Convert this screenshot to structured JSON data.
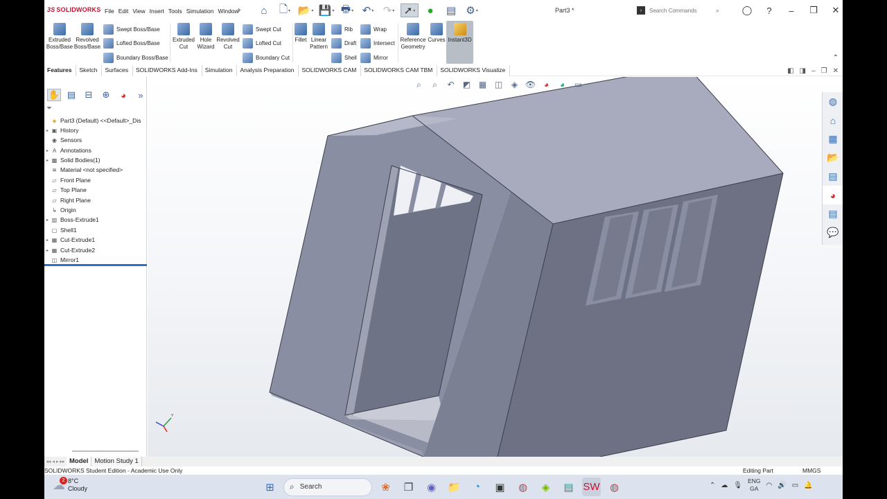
{
  "app": {
    "logo": "SOLIDWORKS",
    "menu": [
      "File",
      "Edit",
      "View",
      "Insert",
      "Tools",
      "Simulation",
      "Window"
    ],
    "document_title": "Part3 *",
    "search_placeholder": "Search Commands"
  },
  "ribbon": {
    "extruded_boss": "Extruded Boss/Base",
    "revolved_boss": "Revolved Boss/Base",
    "swept_boss": "Swept Boss/Base",
    "lofted_boss": "Lofted Boss/Base",
    "boundary_boss": "Boundary Boss/Base",
    "extruded_cut": "Extruded Cut",
    "hole_wizard": "Hole Wizard",
    "revolved_cut": "Revolved Cut",
    "swept_cut": "Swept Cut",
    "lofted_cut": "Lofted Cut",
    "boundary_cut": "Boundary Cut",
    "fillet": "Fillet",
    "linear_pattern": "Linear Pattern",
    "rib": "Rib",
    "draft": "Draft",
    "shell": "Shell",
    "wrap": "Wrap",
    "intersect": "Intersect",
    "mirror": "Mirror",
    "reference_geometry": "Reference Geometry",
    "curves": "Curves",
    "instant3d": "Instant3D"
  },
  "tabs": [
    "Features",
    "Sketch",
    "Surfaces",
    "SOLIDWORKS Add-Ins",
    "Simulation",
    "Analysis Preparation",
    "SOLIDWORKS CAM",
    "SOLIDWORKS CAM TBM",
    "SOLIDWORKS Visualize"
  ],
  "feature_tree": [
    {
      "label": "Part3 (Default) <<Default>_Dis",
      "icon": "part-icon",
      "expandable": false
    },
    {
      "label": "History",
      "icon": "history-icon",
      "expandable": true
    },
    {
      "label": "Sensors",
      "icon": "sensor-icon",
      "expandable": false
    },
    {
      "label": "Annotations",
      "icon": "annotations-icon",
      "expandable": true
    },
    {
      "label": "Solid Bodies(1)",
      "icon": "solid-bodies-icon",
      "expandable": true
    },
    {
      "label": "Material <not specified>",
      "icon": "material-icon",
      "expandable": false
    },
    {
      "label": "Front Plane",
      "icon": "plane-icon",
      "expandable": false
    },
    {
      "label": "Top Plane",
      "icon": "plane-icon",
      "expandable": false
    },
    {
      "label": "Right Plane",
      "icon": "plane-icon",
      "expandable": false
    },
    {
      "label": "Origin",
      "icon": "origin-icon",
      "expandable": false
    },
    {
      "label": "Boss-Extrude1",
      "icon": "extrude-icon",
      "expandable": true
    },
    {
      "label": "Shell1",
      "icon": "shell-icon",
      "expandable": false
    },
    {
      "label": "Cut-Extrude1",
      "icon": "cut-icon",
      "expandable": true
    },
    {
      "label": "Cut-Extrude2",
      "icon": "cut-icon",
      "expandable": true
    },
    {
      "label": "Mirror1",
      "icon": "mirror-icon",
      "expandable": false
    }
  ],
  "bottom_tabs": [
    "Model",
    "Motion Study 1"
  ],
  "status": {
    "left": "SOLIDWORKS Student Edition - Academic Use Only",
    "mode": "Editing Part",
    "units": "MMGS"
  },
  "taskbar": {
    "notification_count": "2",
    "temperature": "8°C",
    "weather": "Cloudy",
    "search_label": "Search",
    "language": "ENG",
    "region": "GA"
  },
  "colors": {
    "model_face_light": "#a7abbd",
    "model_face_mid": "#8a8ea2",
    "model_face_dark": "#6d7183",
    "accent_red": "#c8102e",
    "rollback_bar": "#2a6fc8"
  }
}
